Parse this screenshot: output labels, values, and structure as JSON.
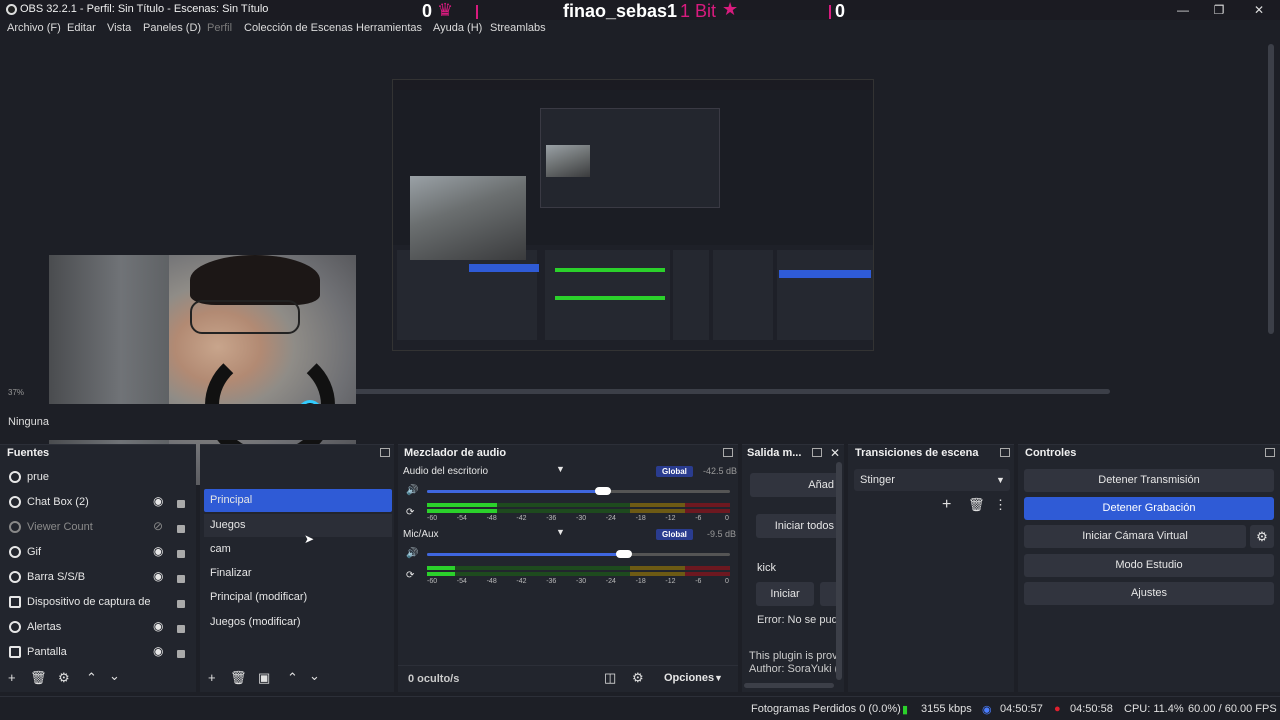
{
  "window": {
    "title": "OBS 32.2.1 - Perfil: Sin Título - Escenas: Sin Título",
    "overlay": {
      "left_count": "0",
      "username": "finao_sebas1",
      "bits": "1 Bit",
      "right_count": "0"
    }
  },
  "menu": [
    "Archivo (F)",
    "Editar",
    "Vista",
    "Paneles (D)",
    "Perfil",
    "Colección de Escenas",
    "Herramientas",
    "Ayuda (H)",
    "Streamlabs"
  ],
  "preview": {
    "zoom": "37%"
  },
  "scene_bar": {
    "text": "Ninguna"
  },
  "sources": {
    "title": "Fuentes",
    "items": [
      {
        "label": "prue"
      },
      {
        "label": "Chat Box (2)"
      },
      {
        "label": "Viewer Count"
      },
      {
        "label": "Gif"
      },
      {
        "label": "Barra S/S/B"
      },
      {
        "label": "Dispositivo de captura de"
      },
      {
        "label": "Alertas"
      },
      {
        "label": "Pantalla"
      }
    ]
  },
  "scenes": {
    "items": [
      "Principal",
      "Juegos",
      "cam",
      "Finalizar",
      "Principal (modificar)",
      "Juegos (modificar)"
    ]
  },
  "mixer": {
    "title": "Mezclador de audio",
    "channels": [
      {
        "name": "Audio del escritorio",
        "tag": "Global",
        "db": "-42.5 dB",
        "level": 0.58
      },
      {
        "name": "Mic/Aux",
        "tag": "Global",
        "db": "-9.5 dB",
        "level": 0.65
      }
    ],
    "ticks": [
      "-60",
      "-54",
      "-48",
      "-42",
      "-36",
      "-30",
      "-24",
      "-18",
      "-12",
      "-6",
      "0"
    ],
    "hidden": "0 oculto/s",
    "options": "Opciones"
  },
  "output": {
    "title": "Salida m...",
    "add_btn": "Añad",
    "start_all": "Iniciar todos",
    "platform": "kick",
    "start": "Iniciar",
    "error": "Error: No se pud",
    "plugin_note": "This plugin is prov",
    "author": "Author: SoraYuki ("
  },
  "transitions": {
    "title": "Transiciones de escena",
    "selected": "Stinger"
  },
  "controls": {
    "title": "Controles",
    "stop_stream": "Detener Transmisión",
    "stop_record": "Detener Grabación",
    "virtual_cam": "Iniciar Cámara Virtual",
    "studio": "Modo Estudio",
    "settings": "Ajustes"
  },
  "status": {
    "dropped": "Fotogramas Perdidos 0 (0.0%)",
    "bitrate": "3155 kbps",
    "stream_time": "04:50:57",
    "rec_time": "04:50:58",
    "cpu": "CPU: 11.4%",
    "fps": "60.00 / 60.00 FPS"
  },
  "colors": {
    "accent": "#2f5bd6",
    "pink": "#d81b7e",
    "meter_green": "#2bd12b",
    "meter_yellow": "#c9a21f",
    "meter_red": "#c81e2b"
  }
}
